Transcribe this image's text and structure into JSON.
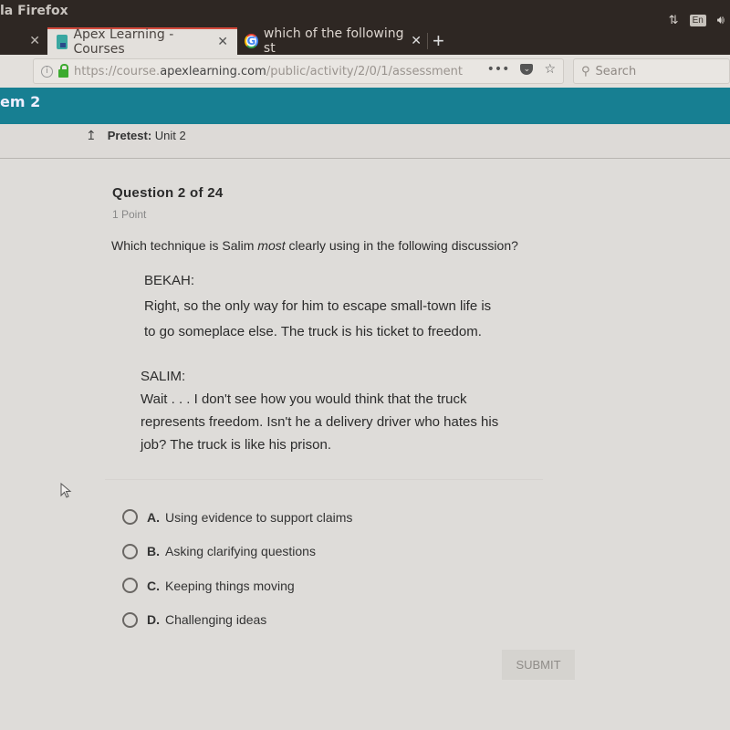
{
  "os": {
    "window_title": "la Firefox",
    "tray": {
      "network_icon": "network-arrows-icon",
      "keyboard_layout": "En",
      "volume_icon": "volume-icon"
    }
  },
  "browser": {
    "tabs": [
      {
        "label": "",
        "icon": "close-icon",
        "state": "previous"
      },
      {
        "label": "Apex Learning - Courses",
        "icon": "apex-favicon",
        "state": "active"
      },
      {
        "label": "which of the following st",
        "icon": "google-favicon",
        "state": "inactive"
      }
    ],
    "close_glyph": "✕",
    "new_tab_glyph": "+",
    "url": {
      "scheme_prefix": "https://course.",
      "host": "apexlearning.com",
      "path": "/public/activity/2/0/1/assessment"
    },
    "url_actions": {
      "more": "•••",
      "pocket": "pocket-icon",
      "bookmark": "☆"
    },
    "search_placeholder": "Search"
  },
  "app": {
    "header_title": "em 2",
    "breadcrumb": {
      "label": "Pretest:",
      "value": "Unit 2",
      "icon": "↥"
    },
    "question": {
      "title": "Question 2 of 24",
      "points": "1 Point",
      "prompt_before": "Which technique is Salim ",
      "prompt_emphasis": "most",
      "prompt_after": " clearly using in the following discussion?",
      "passage": [
        {
          "speaker": "BEKAH:",
          "lines": [
            "Right, so the only way for him to escape small-town life is",
            "to go someplace else. The truck is his ticket to freedom."
          ]
        },
        {
          "speaker": "SALIM:",
          "lines": [
            "Wait . . . I don't see how you would think that the truck",
            "represents freedom. Isn't he a delivery driver who hates his",
            "job? The truck is like his prison."
          ]
        }
      ],
      "options": [
        {
          "letter": "A.",
          "text": "Using evidence to support claims",
          "selected": false
        },
        {
          "letter": "B.",
          "text": "Asking clarifying questions",
          "selected": false
        },
        {
          "letter": "C.",
          "text": "Keeping things moving",
          "selected": false
        },
        {
          "letter": "D.",
          "text": "Challenging ideas",
          "selected": false
        }
      ],
      "submit_label": "SUBMIT",
      "submit_enabled": false
    }
  },
  "colors": {
    "header_teal": "#177f92",
    "active_tab_accent": "#d44a3c",
    "lock_green": "#3caa2f"
  }
}
